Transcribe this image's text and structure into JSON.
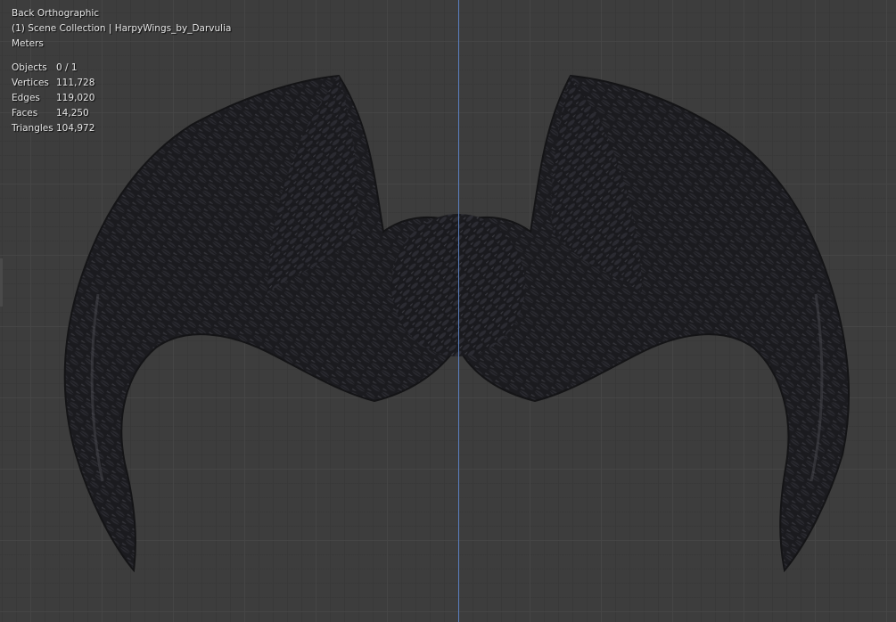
{
  "viewport": {
    "view_name": "Back Orthographic",
    "collection": "(1) Scene Collection | HarpyWings_by_Darvulia",
    "units": "Meters"
  },
  "stats": [
    {
      "label": "Objects",
      "value": "0 / 1"
    },
    {
      "label": "Vertices",
      "value": "111,728"
    },
    {
      "label": "Edges",
      "value": "119,020"
    },
    {
      "label": "Faces",
      "value": "14,250"
    },
    {
      "label": "Triangles",
      "value": "104,972"
    }
  ],
  "colors": {
    "background": "#3d3d3d",
    "z_axis": "#5a7fbf",
    "feathers": "#1c1c20"
  }
}
